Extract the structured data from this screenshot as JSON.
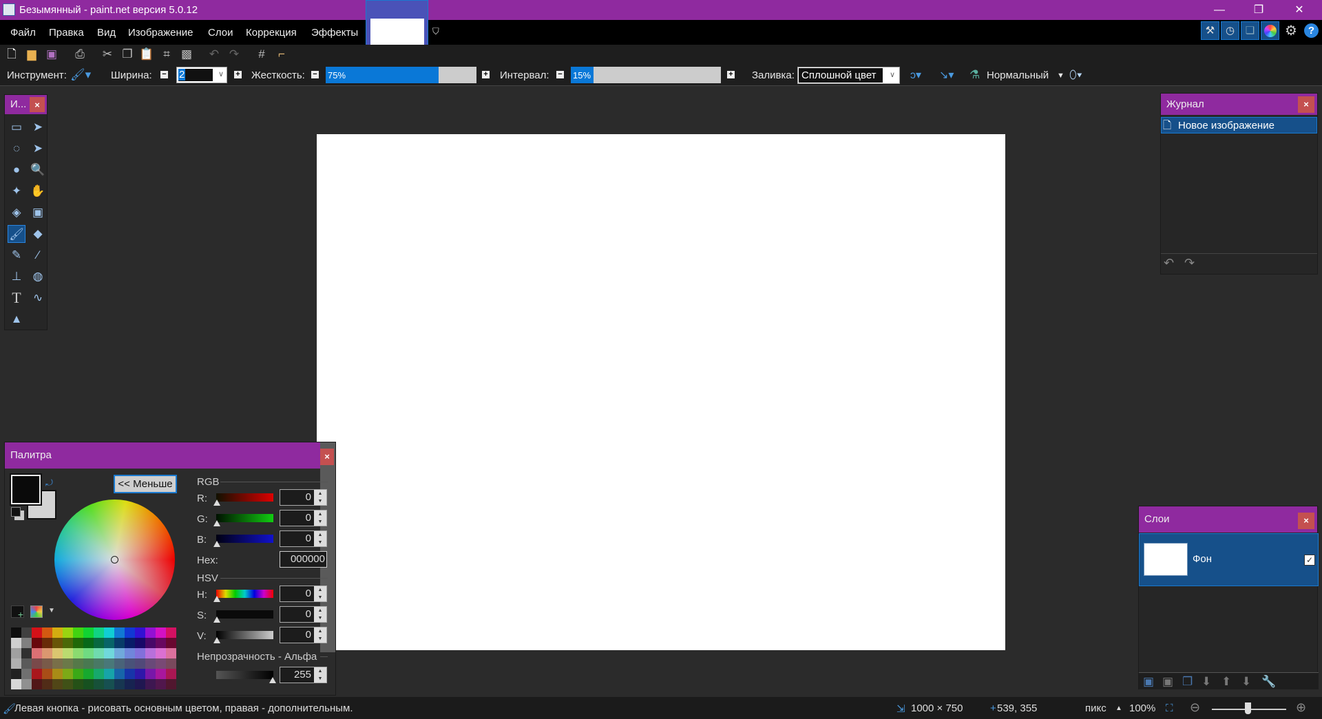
{
  "window": {
    "title": "Безымянный - paint.net версия 5.0.12",
    "minimize": "—",
    "restore": "❐",
    "close": "✕"
  },
  "menu": [
    "Файл",
    "Правка",
    "Вид",
    "Изображение",
    "Слои",
    "Коррекция",
    "Эффекты"
  ],
  "toolbar_icons": [
    "new-file",
    "open-file",
    "save",
    "print",
    "cut",
    "copy",
    "paste",
    "crop",
    "deselect",
    "undo",
    "redo",
    "grid",
    "rulers"
  ],
  "options": {
    "tool_label": "Инструмент:",
    "width_label": "Ширина:",
    "width_value": "2",
    "hardness_label": "Жесткость:",
    "hardness_value": "75%",
    "hardness_fraction": 0.75,
    "interval_label": "Интервал:",
    "interval_value": "15%",
    "interval_fraction": 0.15,
    "fill_label": "Заливка:",
    "fill_value": "Сплошной цвет",
    "blend_value": "Нормальный"
  },
  "tools_panel": {
    "title": "И...",
    "close": "×"
  },
  "tools": [
    "rectangle-select",
    "move-selection",
    "lasso-select",
    "move-selected",
    "ellipse-select",
    "zoom",
    "magic-wand",
    "pan",
    "paint-bucket",
    "gradient",
    "paintbrush",
    "eraser",
    "pencil",
    "color-picker",
    "clone-stamp",
    "recolor",
    "text",
    "line-curve",
    "shapes"
  ],
  "history": {
    "title": "Журнал",
    "close": "×",
    "items": [
      "Новое изображение"
    ]
  },
  "layers": {
    "title": "Слои",
    "close": "×",
    "items": [
      {
        "name": "Фон",
        "visible": true
      }
    ]
  },
  "palette": {
    "title": "Палитра",
    "close": "×",
    "less_button": "<< Меньше",
    "rgb_label": "RGB",
    "r_label": "R:",
    "g_label": "G:",
    "b_label": "B:",
    "r": "0",
    "g": "0",
    "b": "0",
    "hex_label": "Hex:",
    "hex": "000000",
    "hsv_label": "HSV",
    "h_label": "H:",
    "s_label": "S:",
    "v_label": "V:",
    "h": "0",
    "s": "0",
    "v": "0",
    "alpha_label": "Непрозрачность - Альфа",
    "alpha": "255",
    "primary_color": "#0a0a0a",
    "secondary_color": "#d4d4d4",
    "swatch_hues": [
      358,
      22,
      48,
      78,
      105,
      130,
      155,
      182,
      208,
      228,
      250,
      280,
      305,
      335
    ]
  },
  "status": {
    "hint": "Левая кнопка - рисовать основным цветом, правая - дополнительным.",
    "image_size": "1000 × 750",
    "cursor": "539, 355",
    "units": "пикс",
    "zoom": "100%"
  },
  "colors": {
    "accent": "#8f2a9f",
    "selection": "#16508a"
  }
}
